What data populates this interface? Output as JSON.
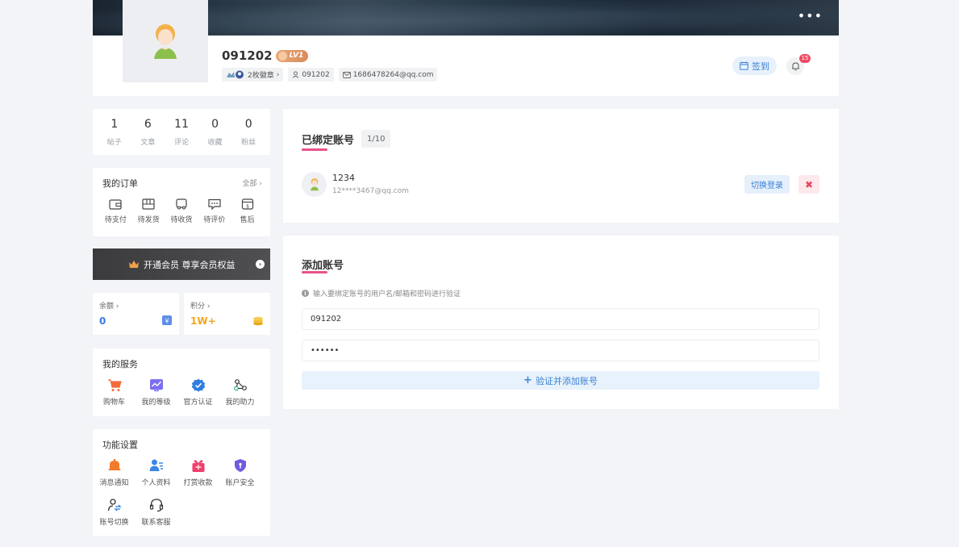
{
  "header": {
    "more_icon": "ellipsis-icon",
    "username": "091202",
    "level": "LV1",
    "badges_label": "2枚徽章",
    "user_id": "091202",
    "email": "1686478264@qq.com",
    "signin_label": "签到",
    "notification_count": "15"
  },
  "stats": [
    {
      "num": "1",
      "label": "帖子"
    },
    {
      "num": "6",
      "label": "文章"
    },
    {
      "num": "11",
      "label": "评论"
    },
    {
      "num": "0",
      "label": "收藏"
    },
    {
      "num": "0",
      "label": "粉丝"
    }
  ],
  "orders": {
    "title": "我的订单",
    "more": "全部",
    "items": [
      {
        "label": "待支付",
        "icon": "wallet-icon"
      },
      {
        "label": "待发货",
        "icon": "package-icon"
      },
      {
        "label": "待收货",
        "icon": "truck-icon"
      },
      {
        "label": "待评价",
        "icon": "comment-icon"
      },
      {
        "label": "售后",
        "icon": "after-sale-icon"
      }
    ]
  },
  "vip": {
    "label": "开通会员 尊享会员权益"
  },
  "wallet": {
    "balance_label": "余额",
    "balance_value": "0",
    "points_label": "积分",
    "points_value": "1W+",
    "balance_color": "#3b7ae0",
    "points_color": "#f2a51d"
  },
  "services": {
    "title": "我的服务",
    "items": [
      {
        "label": "购物车",
        "icon": "cart-icon"
      },
      {
        "label": "我的等级",
        "icon": "level-chart-icon"
      },
      {
        "label": "官方认证",
        "icon": "verified-icon"
      },
      {
        "label": "我的助力",
        "icon": "share-icon"
      }
    ]
  },
  "settings": {
    "title": "功能设置",
    "items": [
      {
        "label": "消息通知",
        "icon": "bell-icon"
      },
      {
        "label": "个人资料",
        "icon": "profile-icon"
      },
      {
        "label": "打赏收款",
        "icon": "gift-icon"
      },
      {
        "label": "账户安全",
        "icon": "shield-icon"
      },
      {
        "label": "账号切换",
        "icon": "switch-account-icon"
      },
      {
        "label": "联系客服",
        "icon": "headset-icon"
      }
    ]
  },
  "bound": {
    "title": "已绑定账号",
    "count": "1/10",
    "account_name": "1234",
    "account_email": "12****3467@qq.com",
    "switch_label": "切换登录",
    "delete_icon": "close-icon"
  },
  "add": {
    "title": "添加账号",
    "hint": "输入要绑定账号的用户名/邮箱和密码进行验证",
    "username_value": "091202",
    "password_value": "••••••",
    "submit_label": "验证并添加账号"
  },
  "colors": {
    "accent_pink": "#e8528a",
    "accent_blue": "#3b82d6",
    "badge_red": "#f04a63"
  }
}
